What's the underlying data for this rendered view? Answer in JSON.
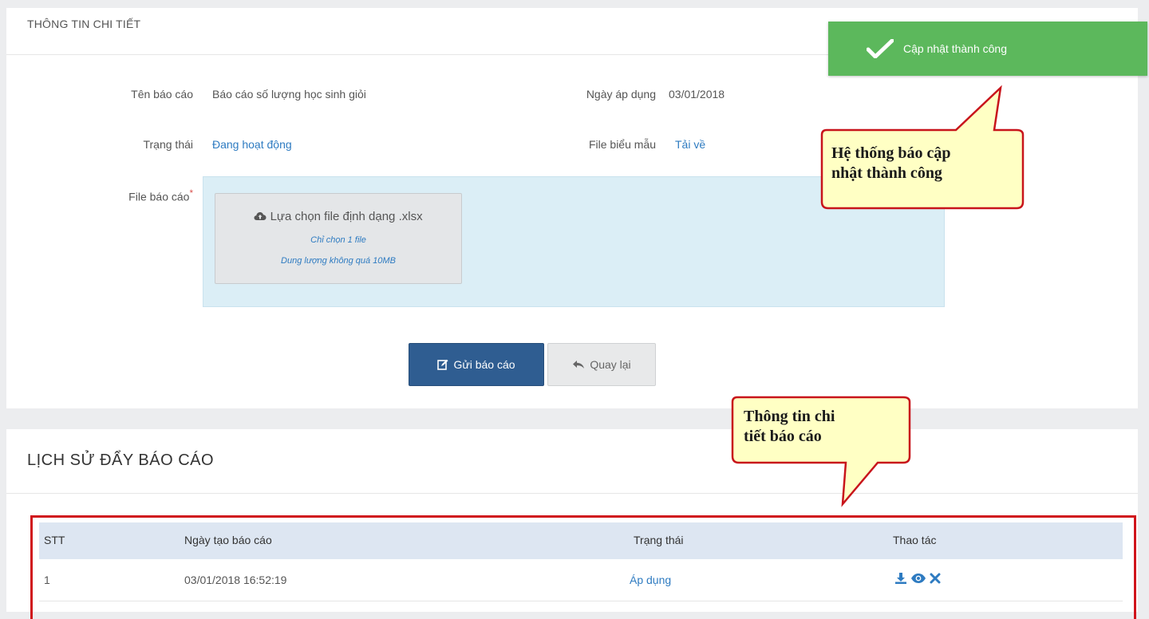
{
  "detail": {
    "title": "THÔNG TIN CHI TIẾT",
    "report_name_label": "Tên báo cáo",
    "report_name_value": "Báo cáo số lượng học sinh giỏi",
    "apply_date_label": "Ngày áp dụng",
    "apply_date_value": "03/01/2018",
    "status_label": "Trạng thái",
    "status_value": "Đang hoạt động",
    "template_label": "File biểu mẫu",
    "template_link": "Tải về",
    "report_file_label": "File báo cáo",
    "required_mark": "*",
    "upload": {
      "main": "Lựa chọn file định dạng .xlsx",
      "hint1": "Chỉ chọn 1 file",
      "hint2": "Dung lượng không quá 10MB"
    },
    "send_button": "Gửi báo cáo",
    "back_button": "Quay lại"
  },
  "history": {
    "title": "LỊCH SỬ ĐẨY BÁO CÁO",
    "columns": [
      "STT",
      "Ngày tạo báo cáo",
      "Trạng thái",
      "Thao tác"
    ],
    "rows": [
      {
        "stt": "1",
        "created": "03/01/2018 16:52:19",
        "status": "Áp dụng"
      }
    ]
  },
  "toast": {
    "message": "Cập nhật thành công"
  },
  "callouts": {
    "toast_note": [
      "Hệ thống báo cập",
      "nhật thành công"
    ],
    "table_note": [
      "Thông tin chi",
      "tiết báo cáo"
    ]
  },
  "colors": {
    "primary": "#2f5d91",
    "link": "#2e7bc1",
    "success": "#5cb85c",
    "highlight_frame": "#d0141b",
    "callout_fill": "#ffffc4",
    "callout_border": "#c8141b"
  },
  "icons": [
    "cloud-upload-icon",
    "edit-icon",
    "reply-icon",
    "download-icon",
    "eye-icon",
    "delete-icon",
    "check-icon"
  ]
}
